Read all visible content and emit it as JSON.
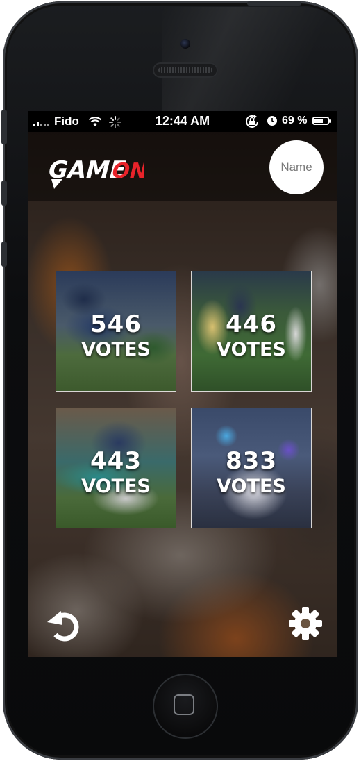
{
  "status_bar": {
    "carrier": "Fido",
    "time": "12:44 AM",
    "battery_percent": "69 %",
    "battery_level": 0.69,
    "icons": [
      "signal-icon",
      "wifi-icon",
      "activity-spinner-icon",
      "rotation-lock-icon",
      "alarm-icon",
      "battery-icon"
    ]
  },
  "header": {
    "logo_text_game": "GAME",
    "logo_text_on": "ON",
    "name_button": "Name"
  },
  "tiles": [
    {
      "count": "546",
      "label": "VOTES"
    },
    {
      "count": "446",
      "label": "VOTES"
    },
    {
      "count": "443",
      "label": "VOTES"
    },
    {
      "count": "833",
      "label": "VOTES"
    }
  ],
  "toolbar": {
    "left_icon": "refresh-icon",
    "right_icon": "gear-icon"
  },
  "colors": {
    "logo_white": "#ffffff",
    "logo_red": "#e8232a",
    "status_bar": "#000000"
  }
}
